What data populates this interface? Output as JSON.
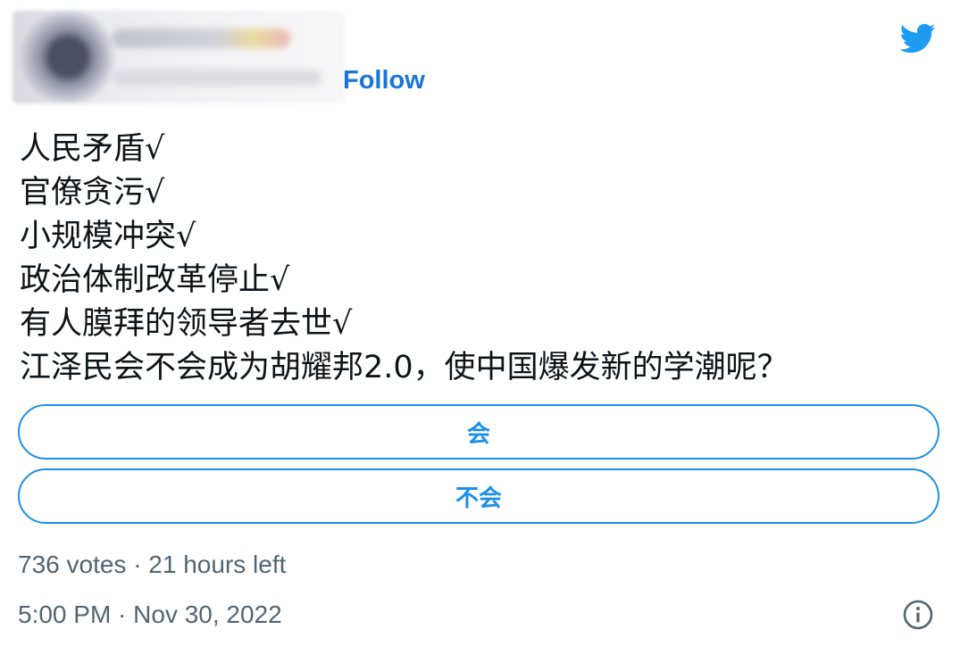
{
  "header": {
    "follow_label": "Follow"
  },
  "icons": {
    "brand": "twitter-bird-icon",
    "info": "info-icon"
  },
  "colors": {
    "follow": "#1b74d8",
    "poll_accent": "#1d8fe8",
    "twitter_blue": "#1d9bf0",
    "meta_text": "#536471"
  },
  "tweet": {
    "lines": [
      "人民矛盾√",
      "官僚贪污√",
      "小规模冲突√",
      "政治体制改革停止√",
      "有人膜拜的领导者去世√",
      "江泽民会不会成为胡耀邦2.0，使中国爆发新的学潮呢？"
    ]
  },
  "poll": {
    "options": [
      {
        "label": "会"
      },
      {
        "label": "不会"
      }
    ],
    "summary": "736 votes · 21 hours left"
  },
  "footer": {
    "timestamp": "5:00 PM · Nov 30, 2022"
  }
}
